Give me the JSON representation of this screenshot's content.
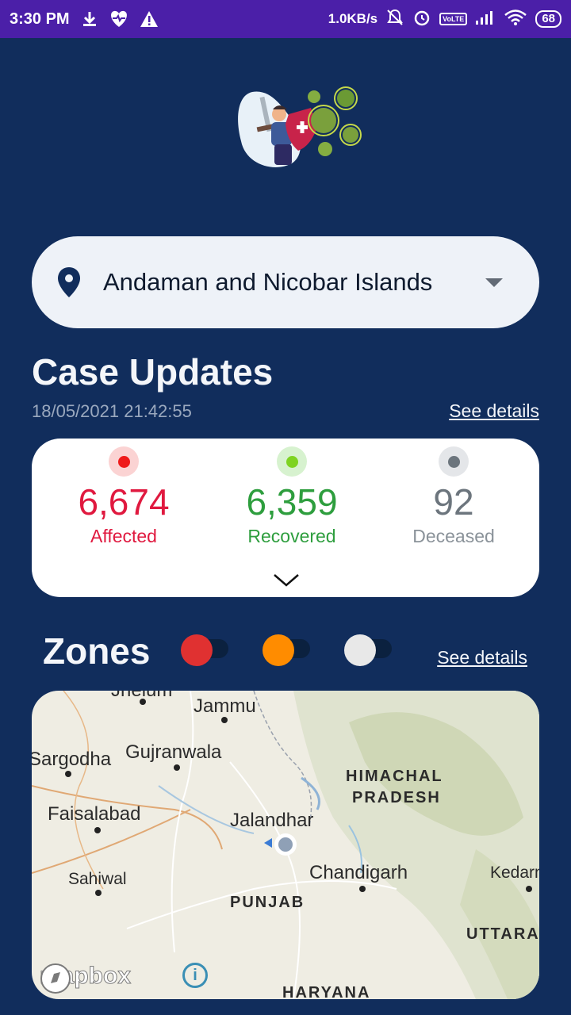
{
  "status_bar": {
    "time": "3:30 PM",
    "network_speed": "1.0KB/s",
    "volte": "VoLTE",
    "battery": "68",
    "icons": [
      "download-icon",
      "heart-icon",
      "warning-icon",
      "mute-icon",
      "alarm-icon",
      "signal-icon",
      "wifi-icon"
    ]
  },
  "location": {
    "selected": "Andaman and Nicobar Islands",
    "icon": "location-pin-icon"
  },
  "case_updates": {
    "title": "Case Updates",
    "timestamp": "18/05/2021 21:42:55",
    "see_details": "See details",
    "stats": [
      {
        "value": "6,674",
        "label": "Affected",
        "color": "#e0193f"
      },
      {
        "value": "6,359",
        "label": "Recovered",
        "color": "#2e9e3e"
      },
      {
        "value": "92",
        "label": "Deceased",
        "color": "#6c757d"
      }
    ]
  },
  "zones": {
    "title": "Zones",
    "see_details": "See details",
    "toggles": [
      {
        "name": "red-zone",
        "color": "#e03131",
        "on": false
      },
      {
        "name": "orange-zone",
        "color": "#ff8c00",
        "on": false
      },
      {
        "name": "green-zone",
        "color": "#e8e8e8",
        "on": false
      }
    ]
  },
  "map": {
    "labels": {
      "jhelum": "Jhelum",
      "jammu": "Jammu",
      "sargodha": "Sargodha",
      "gujranwala": "Gujranwala",
      "himachal": "HIMACHAL",
      "pradesh": "PRADESH",
      "faisalabad": "Faisalabad",
      "jalandhar": "Jalandhar",
      "chandigarh": "Chandigarh",
      "kedarnath": "Kedarn",
      "sahiwal": "Sahiwal",
      "punjab": "PUNJAB",
      "uttarakhand": "UTTARA",
      "haryana": "HARYANA"
    },
    "attribution": "mapbox"
  }
}
